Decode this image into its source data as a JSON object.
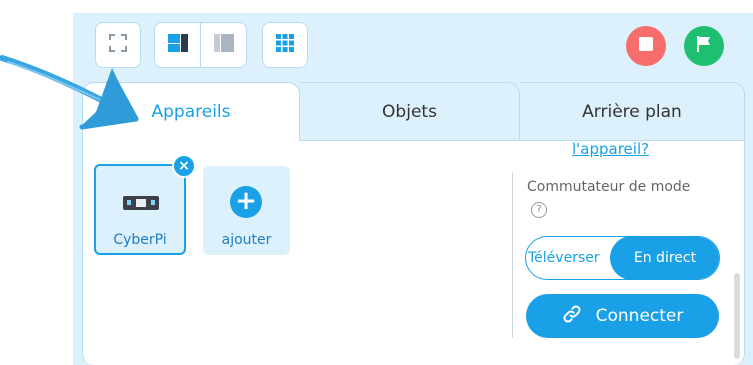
{
  "toolbar": {
    "fullscreen_icon": "fullscreen-icon",
    "layout_icons": [
      "layout-split-icon",
      "layout-stage-icon"
    ],
    "grid_icon": "grid-icon",
    "stop_icon": "stop-icon",
    "go_icon": "flag-icon"
  },
  "tabs": [
    {
      "label": "Appareils",
      "active": true
    },
    {
      "label": "Objets",
      "active": false
    },
    {
      "label": "Arrière plan",
      "active": false
    }
  ],
  "devices": {
    "items": [
      {
        "label": "CyberPi",
        "selected": true
      }
    ],
    "remove_symbol": "×",
    "add_symbol": "+",
    "add_label": "ajouter"
  },
  "side": {
    "cut_link": "l'appareil?",
    "mode_title": "Commutateur de mode",
    "help_symbol": "?",
    "mode_upload": "Téléverser",
    "mode_live": "En direct",
    "connect_label": "Connecter"
  },
  "colors": {
    "accent": "#1aa0e6",
    "panel": "#ddf1fc",
    "stop": "#f76d6d",
    "go": "#1fbf72",
    "annotation_arrow": "#3aa6e0"
  }
}
